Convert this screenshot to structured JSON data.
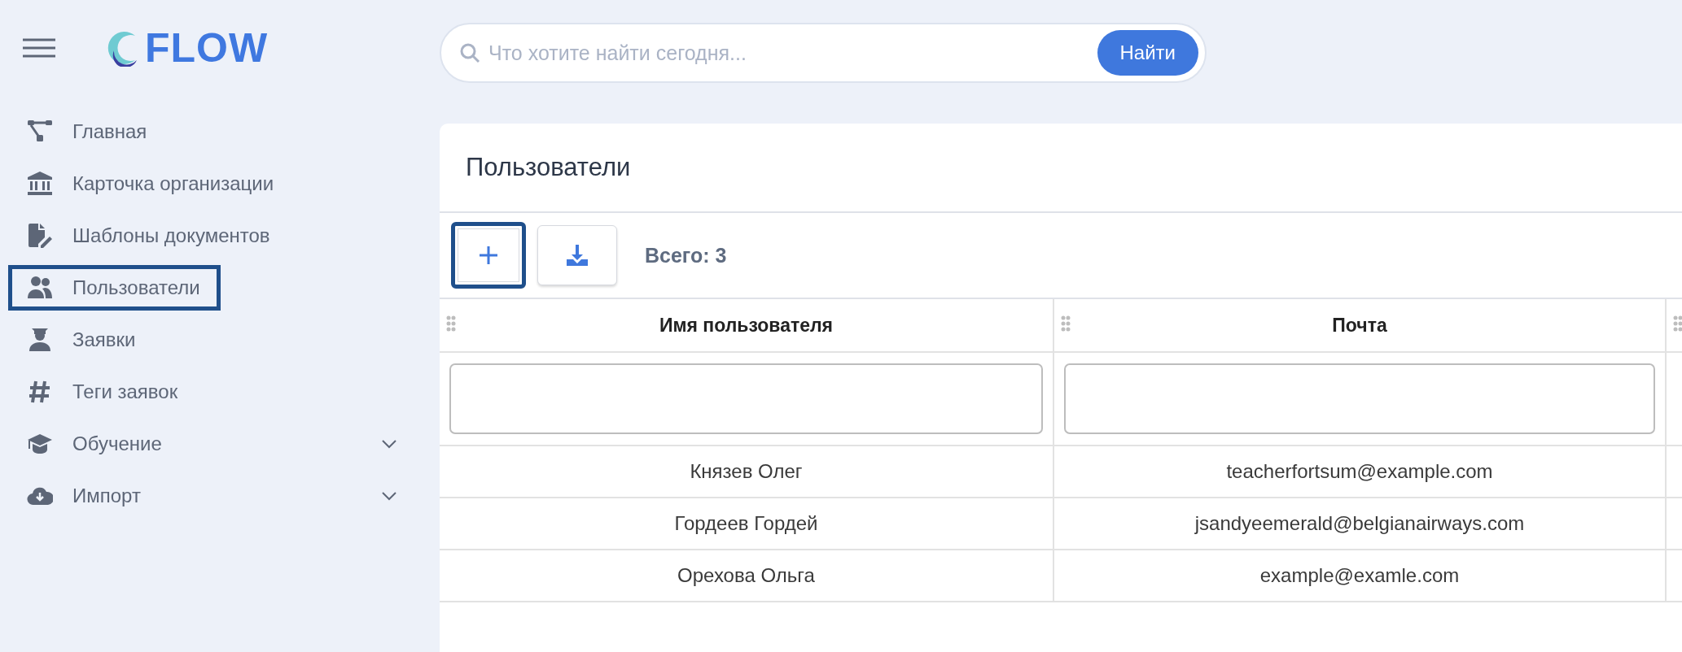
{
  "logo": {
    "text": "FLOW"
  },
  "sidebar": {
    "items": [
      {
        "label": "Главная",
        "kind": "link",
        "selected": false
      },
      {
        "label": "Карточка организации",
        "kind": "link",
        "selected": false
      },
      {
        "label": "Шаблоны документов",
        "kind": "link",
        "selected": false
      },
      {
        "label": "Пользователи",
        "kind": "link",
        "selected": true
      },
      {
        "label": "Заявки",
        "kind": "link",
        "selected": false
      },
      {
        "label": "Теги заявок",
        "kind": "link",
        "selected": false
      },
      {
        "label": "Обучение",
        "kind": "group",
        "expanded": false,
        "selected": false
      },
      {
        "label": "Импорт",
        "kind": "group",
        "expanded": false,
        "selected": false
      }
    ]
  },
  "search": {
    "placeholder": "Что хотите найти сегодня...",
    "button": "Найти"
  },
  "page": {
    "title": "Пользователи",
    "toolbar": {
      "buttons": [
        {
          "kind": "add",
          "highlighted": true
        },
        {
          "kind": "download",
          "highlighted": false
        }
      ],
      "total": "Всего: 3"
    },
    "table": {
      "columns": [
        "Имя пользователя",
        "Почта"
      ],
      "rows": [
        [
          "Князев Олег",
          "teacherfortsum@example.com"
        ],
        [
          "Гордеев Гордей",
          "jsandyeemerald@belgianairways.com"
        ],
        [
          "Орехова Ольга",
          "example@examle.com"
        ]
      ]
    }
  }
}
